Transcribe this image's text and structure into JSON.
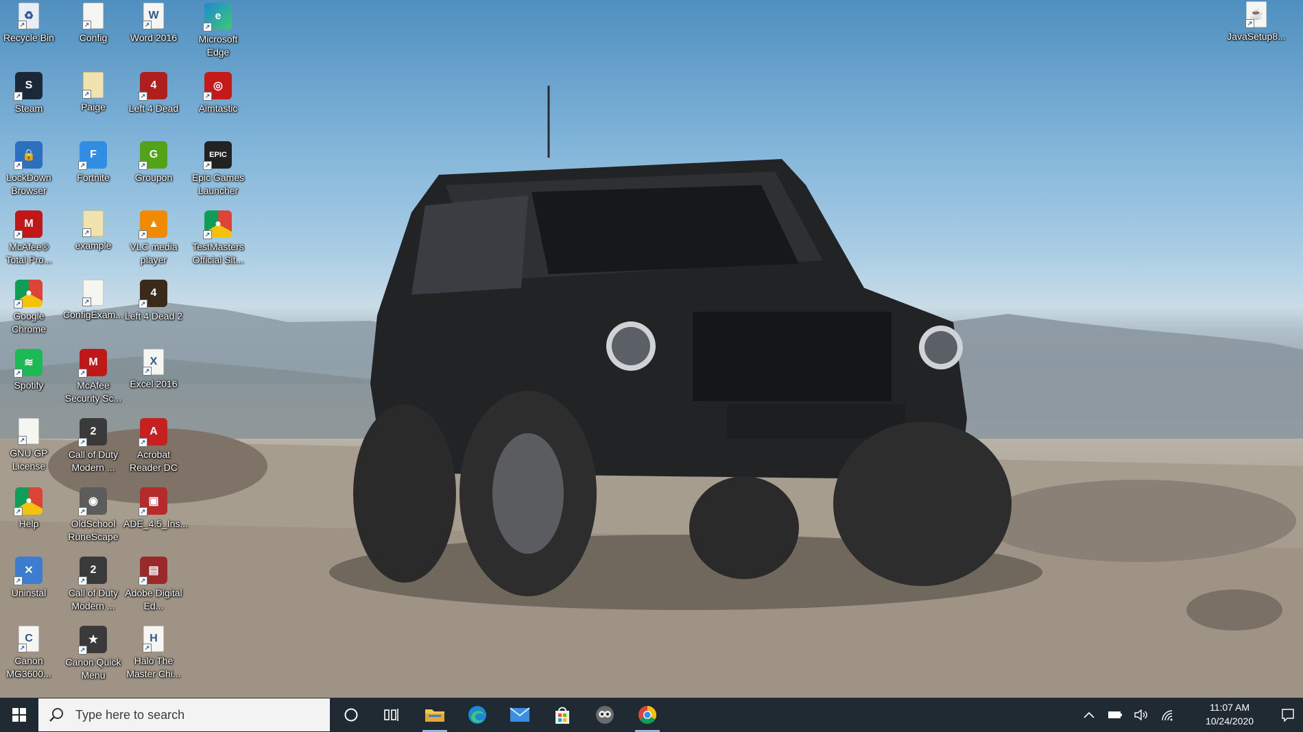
{
  "desktop_icons": [
    {
      "label": "Recycle Bin",
      "icon": "recycle-bin-icon",
      "name": "desktop-icon-recycle-bin"
    },
    {
      "label": "Config",
      "icon": "text-document-icon",
      "name": "desktop-icon-config"
    },
    {
      "label": "Word 2016",
      "icon": "word-document-icon",
      "name": "desktop-icon-word-2016"
    },
    {
      "label": "Microsoft Edge",
      "icon": "edge-browser-icon",
      "name": "desktop-icon-microsoft-edge"
    },
    {
      "label": "Steam",
      "icon": "steam-icon",
      "name": "desktop-icon-steam"
    },
    {
      "label": "Paige",
      "icon": "folder-icon",
      "name": "desktop-icon-paige"
    },
    {
      "label": "Left 4 Dead",
      "icon": "left4dead-icon",
      "name": "desktop-icon-left-4-dead"
    },
    {
      "label": "Aimtastic",
      "icon": "aimtastic-icon",
      "name": "desktop-icon-aimtastic"
    },
    {
      "label": "LockDown Browser",
      "icon": "lockdown-browser-icon",
      "name": "desktop-icon-lockdown-browser"
    },
    {
      "label": "Fortnite",
      "icon": "fortnite-icon",
      "name": "desktop-icon-fortnite"
    },
    {
      "label": "Groupon",
      "icon": "groupon-icon",
      "name": "desktop-icon-groupon"
    },
    {
      "label": "Epic Games Launcher",
      "icon": "epic-games-icon",
      "name": "desktop-icon-epic-games-launcher"
    },
    {
      "label": "McAfee® Total Pro...",
      "icon": "mcafee-icon",
      "name": "desktop-icon-mcafee-total-pro"
    },
    {
      "label": "example",
      "icon": "folder-icon",
      "name": "desktop-icon-example"
    },
    {
      "label": "VLC media player",
      "icon": "vlc-cone-icon",
      "name": "desktop-icon-vlc-media-player"
    },
    {
      "label": "TestMasters Official Sit...",
      "icon": "chrome-icon",
      "name": "desktop-icon-testmasters"
    },
    {
      "label": "Google Chrome",
      "icon": "chrome-icon",
      "name": "desktop-icon-google-chrome"
    },
    {
      "label": "ConfigExam...",
      "icon": "text-document-icon",
      "name": "desktop-icon-configexam"
    },
    {
      "label": "Left 4 Dead 2",
      "icon": "left4dead2-icon",
      "name": "desktop-icon-left-4-dead-2"
    },
    {
      "label": "Spotify",
      "icon": "spotify-icon",
      "name": "desktop-icon-spotify"
    },
    {
      "label": "McAfee Security Sc...",
      "icon": "mcafee-icon",
      "name": "desktop-icon-mcafee-security-scan"
    },
    {
      "label": "Excel 2016",
      "icon": "excel-document-icon",
      "name": "desktop-icon-excel-2016"
    },
    {
      "label": "GNU GP License",
      "icon": "text-document-icon",
      "name": "desktop-icon-gnu-gp-license"
    },
    {
      "label": "Call of Duty Modern ...",
      "icon": "call-of-duty-icon",
      "name": "desktop-icon-call-of-duty-1"
    },
    {
      "label": "Acrobat Reader DC",
      "icon": "acrobat-icon",
      "name": "desktop-icon-acrobat-reader-dc"
    },
    {
      "label": "Help",
      "icon": "chrome-icon",
      "name": "desktop-icon-help"
    },
    {
      "label": "OldSchool RuneScape",
      "icon": "runescape-icon",
      "name": "desktop-icon-oldschool-runescape"
    },
    {
      "label": "ADE_4.5_Ins...",
      "icon": "installer-icon",
      "name": "desktop-icon-ade-installer"
    },
    {
      "label": "Uninstal",
      "icon": "uninstall-icon",
      "name": "desktop-icon-uninstal"
    },
    {
      "label": "Call of Duty Modern ...",
      "icon": "call-of-duty-icon",
      "name": "desktop-icon-call-of-duty-2"
    },
    {
      "label": "Adobe Digital Ed...",
      "icon": "adobe-digital-editions-icon",
      "name": "desktop-icon-adobe-digital-editions"
    },
    {
      "label": "Canon MG3600...",
      "icon": "canon-printer-icon",
      "name": "desktop-icon-canon-mg3600"
    },
    {
      "label": "Canon Quick Menu",
      "icon": "canon-quick-menu-icon",
      "name": "desktop-icon-canon-quick-menu"
    },
    {
      "label": "Halo The Master Chi...",
      "icon": "halo-icon",
      "name": "desktop-icon-halo"
    },
    {
      "label": "JavaSetup8...",
      "icon": "java-setup-icon",
      "name": "desktop-icon-javasetup"
    }
  ],
  "taskbar": {
    "search_placeholder": "Type here to search",
    "pinned": [
      {
        "name": "taskbar-file-explorer",
        "icon": "folder-icon"
      },
      {
        "name": "taskbar-edge",
        "icon": "edge-browser-icon"
      },
      {
        "name": "taskbar-mail",
        "icon": "mail-icon"
      },
      {
        "name": "taskbar-store",
        "icon": "store-icon"
      },
      {
        "name": "taskbar-runescape",
        "icon": "runescape-icon"
      },
      {
        "name": "taskbar-chrome",
        "icon": "chrome-icon"
      }
    ]
  },
  "clock": {
    "time": "11:07 AM",
    "date": "10/24/2020"
  },
  "colors": {
    "taskbar": "#1f2a33",
    "accent_underline": "#8fb8e0"
  }
}
